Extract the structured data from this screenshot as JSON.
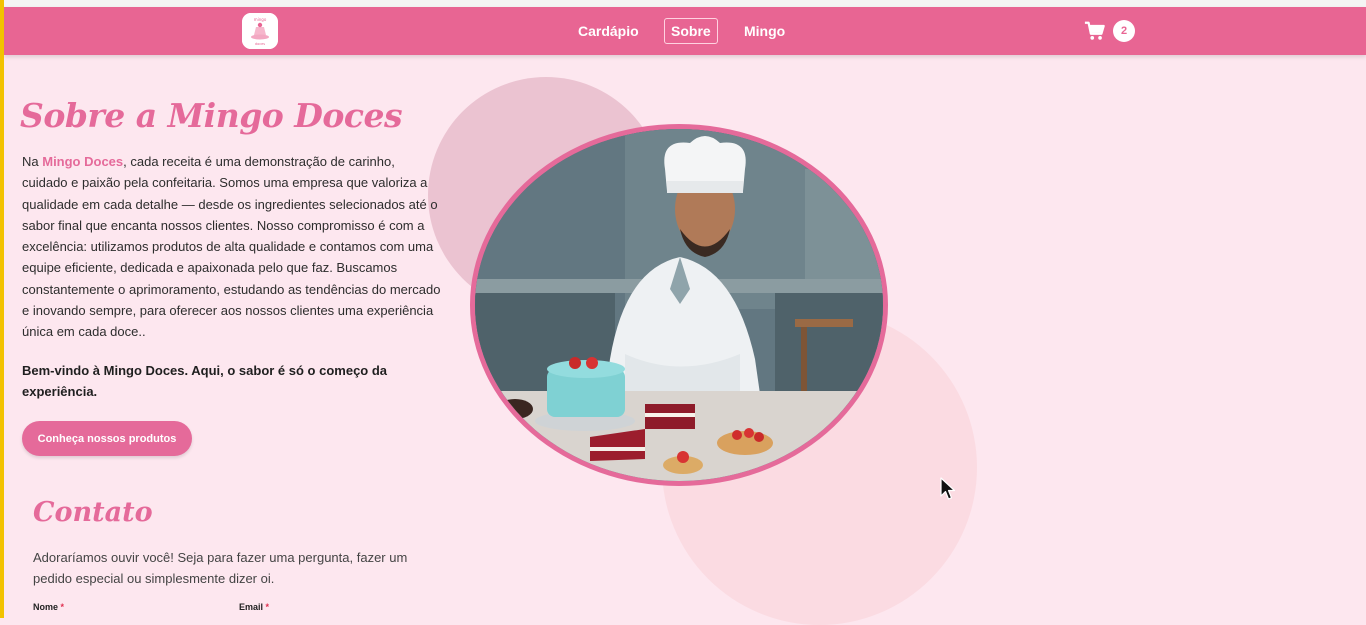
{
  "colors": {
    "brand_pink": "#e86593",
    "title_pink": "#e56a9a",
    "background": "#fde7ef",
    "required_red": "#e0304f"
  },
  "header": {
    "logo_icon": "mingo-doces-logo",
    "nav": [
      {
        "label": "Cardápio",
        "active": false
      },
      {
        "label": "Sobre",
        "active": true
      },
      {
        "label": "Mingo",
        "active": false
      }
    ],
    "cart": {
      "icon": "shopping-cart-icon",
      "count": "2"
    }
  },
  "about": {
    "title": "Sobre a Mingo Doces",
    "intro_prefix": "Na ",
    "brand_name": "Mingo Doces",
    "intro_rest": ", cada receita é uma demonstração de carinho, cuidado e paixão pela confeitaria. Somos uma empresa que valoriza a qualidade em cada detalhe — desde os ingredientes selecionados até o sabor final que encanta nossos clientes. Nosso compromisso é com a excelência: utilizamos produtos de alta qualidade e contamos com uma equipe eficiente, dedicada e apaixonada pelo que faz. Buscamos constantemente o aprimoramento, estudando as tendências do mercado e inovando sempre, para oferecer aos nossos clientes uma experiência única em cada doce..",
    "welcome": "Bem-vindo à Mingo Doces. Aqui, o sabor é só o começo da experiência.",
    "cta_label": "Conheça nossos produtos"
  },
  "contact": {
    "title": "Contato",
    "text": "Adoraríamos ouvir você! Seja para fazer uma pergunta, fazer um pedido especial ou simplesmente dizer oi.",
    "fields": [
      {
        "label": "Nome",
        "required": "*"
      },
      {
        "label": "Email",
        "required": "*"
      }
    ]
  }
}
